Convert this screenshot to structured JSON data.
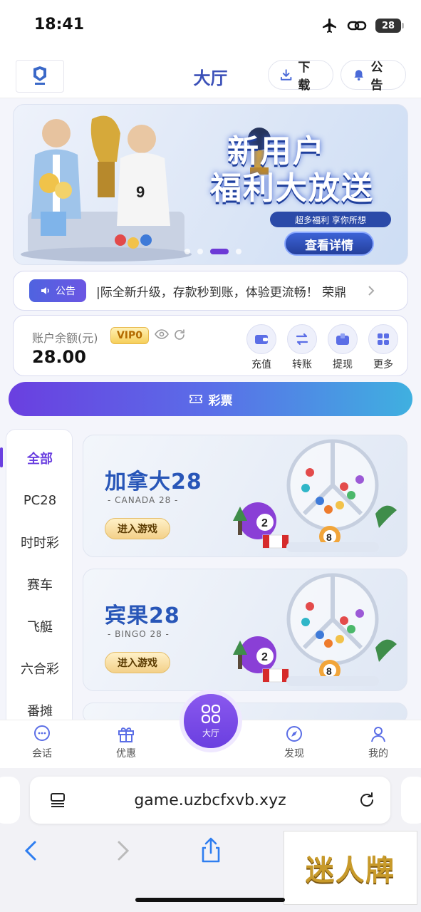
{
  "status": {
    "time": "18:41",
    "battery": "28"
  },
  "header": {
    "title": "大厅",
    "download_label": "下载",
    "notice_label": "公告"
  },
  "banner": {
    "title_line1": "新用户",
    "title_line2": "福利大放送",
    "subtitle": "超多福利 享你所想",
    "cta_label": "查看详情",
    "slide_count": 4,
    "active_slide": 3
  },
  "notice": {
    "badge_label": "公告",
    "text": "|际全新升级，存款秒到账，体验更流畅！  荣鼎"
  },
  "account": {
    "balance_label": "账户余额(元)",
    "vip_label": "VIP0",
    "balance_value": "28.00",
    "actions": [
      {
        "label": "充值",
        "icon": "wallet-icon"
      },
      {
        "label": "转账",
        "icon": "transfer-icon"
      },
      {
        "label": "提现",
        "icon": "withdraw-icon"
      },
      {
        "label": "更多",
        "icon": "grid-icon"
      }
    ]
  },
  "lottery_bar": {
    "label": "彩票"
  },
  "categories": [
    "全部",
    "PC28",
    "时时彩",
    "赛车",
    "飞艇",
    "六合彩",
    "番摊"
  ],
  "active_category": "全部",
  "games": [
    {
      "title": "加拿大28",
      "subtitle": "- CANADA 28 -",
      "button_label": "进入游戏"
    },
    {
      "title": "宾果28",
      "subtitle": "- BINGO 28 -",
      "button_label": "进入游戏"
    }
  ],
  "tabbar": {
    "items": [
      {
        "label": "会话",
        "icon": "chat-icon"
      },
      {
        "label": "优惠",
        "icon": "gift-icon"
      },
      {
        "label": "发现",
        "icon": "compass-icon"
      },
      {
        "label": "我的",
        "icon": "profile-icon"
      }
    ],
    "center_label": "大厅"
  },
  "browser": {
    "url": "game.uzbcfxvb.xyz"
  },
  "watermark": {
    "text": "迷人牌"
  },
  "colors": {
    "accent": "#6a3fe0",
    "title_blue": "#3b50b8",
    "game_blue": "#2856b8",
    "gold": "#f3d089"
  }
}
